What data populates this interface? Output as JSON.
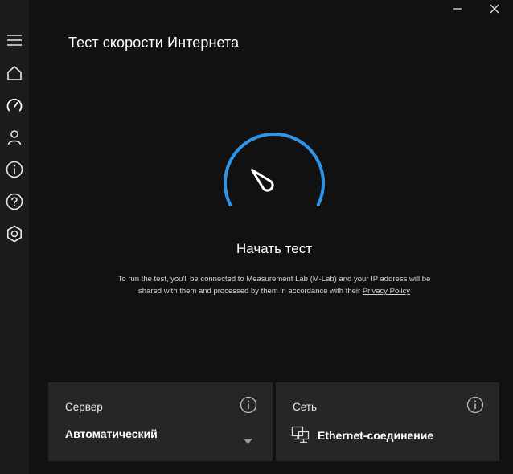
{
  "window": {
    "title": "Тест скорости Интернета"
  },
  "sidebar": {
    "items": [
      {
        "name": "menu",
        "icon": "hamburger-menu-icon"
      },
      {
        "name": "home",
        "icon": "home-icon"
      },
      {
        "name": "speedtest",
        "icon": "speedometer-icon",
        "active": true
      },
      {
        "name": "account",
        "icon": "user-icon"
      },
      {
        "name": "info",
        "icon": "info-icon"
      },
      {
        "name": "help",
        "icon": "help-icon"
      },
      {
        "name": "settings",
        "icon": "settings-icon"
      }
    ]
  },
  "main": {
    "start_label": "Начать тест",
    "disclaimer_text": "To run the test, you'll be connected to Measurement Lab (M-Lab) and your IP address will be shared with them and processed by them in accordance with their",
    "privacy_link": "Privacy Policy"
  },
  "cards": {
    "server": {
      "label": "Сервер",
      "value": "Автоматический"
    },
    "network": {
      "label": "Сеть",
      "value": "Ethernet-соединение"
    }
  },
  "colors": {
    "background": "#111112",
    "sidebar": "#1c1c1e",
    "card": "#262627",
    "accent": "#2f95e8",
    "text": "#ffffff"
  }
}
